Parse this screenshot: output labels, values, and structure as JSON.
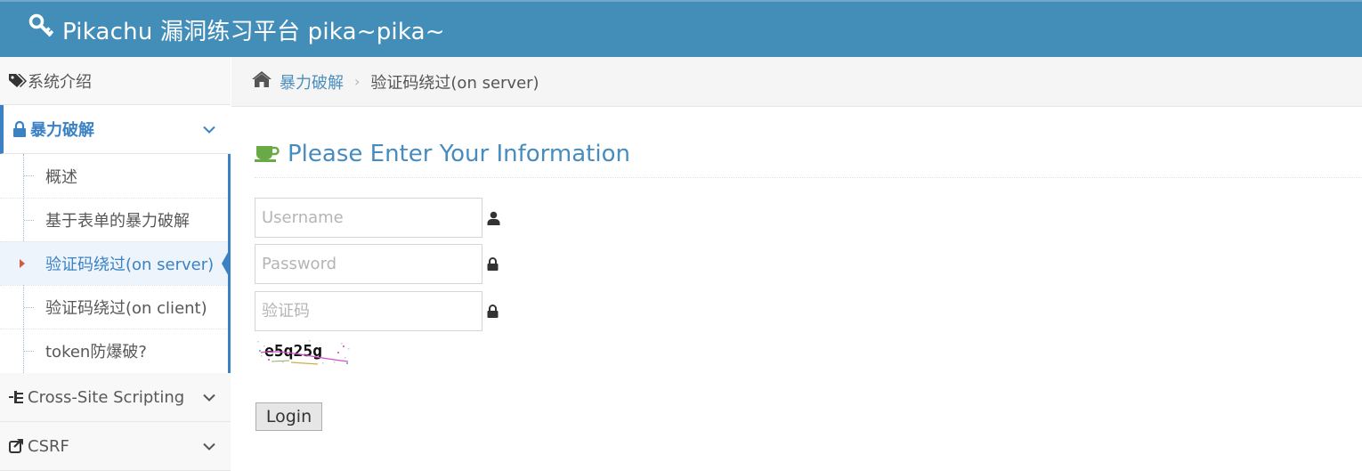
{
  "app": {
    "title": "Pikachu 漏洞练习平台 pika~pika~"
  },
  "sidebar": {
    "items": [
      {
        "label": "系统介绍",
        "icon": "tags-icon"
      },
      {
        "label": "暴力破解",
        "icon": "lock-icon",
        "expanded": true
      },
      {
        "label": "Cross-Site Scripting",
        "icon": "sitemap-icon"
      },
      {
        "label": "CSRF",
        "icon": "share-icon"
      }
    ],
    "submenu": [
      {
        "label": "概述"
      },
      {
        "label": "基于表单的暴力破解"
      },
      {
        "label": "验证码绕过(on server)",
        "active": true
      },
      {
        "label": "验证码绕过(on client)"
      },
      {
        "label": "token防爆破?"
      }
    ]
  },
  "breadcrumb": {
    "home_icon": "home-icon",
    "link": "暴力破解",
    "current": "验证码绕过(on server)"
  },
  "form": {
    "header": "Please Enter Your Information",
    "username_placeholder": "Username",
    "password_placeholder": "Password",
    "captcha_placeholder": "验证码",
    "captcha_text": "e5q25g",
    "login_label": "Login"
  },
  "colors": {
    "navbar": "#438eb9",
    "accent": "#3b82c4",
    "header_text": "#2679b5",
    "cup_icon": "#69aa46"
  }
}
